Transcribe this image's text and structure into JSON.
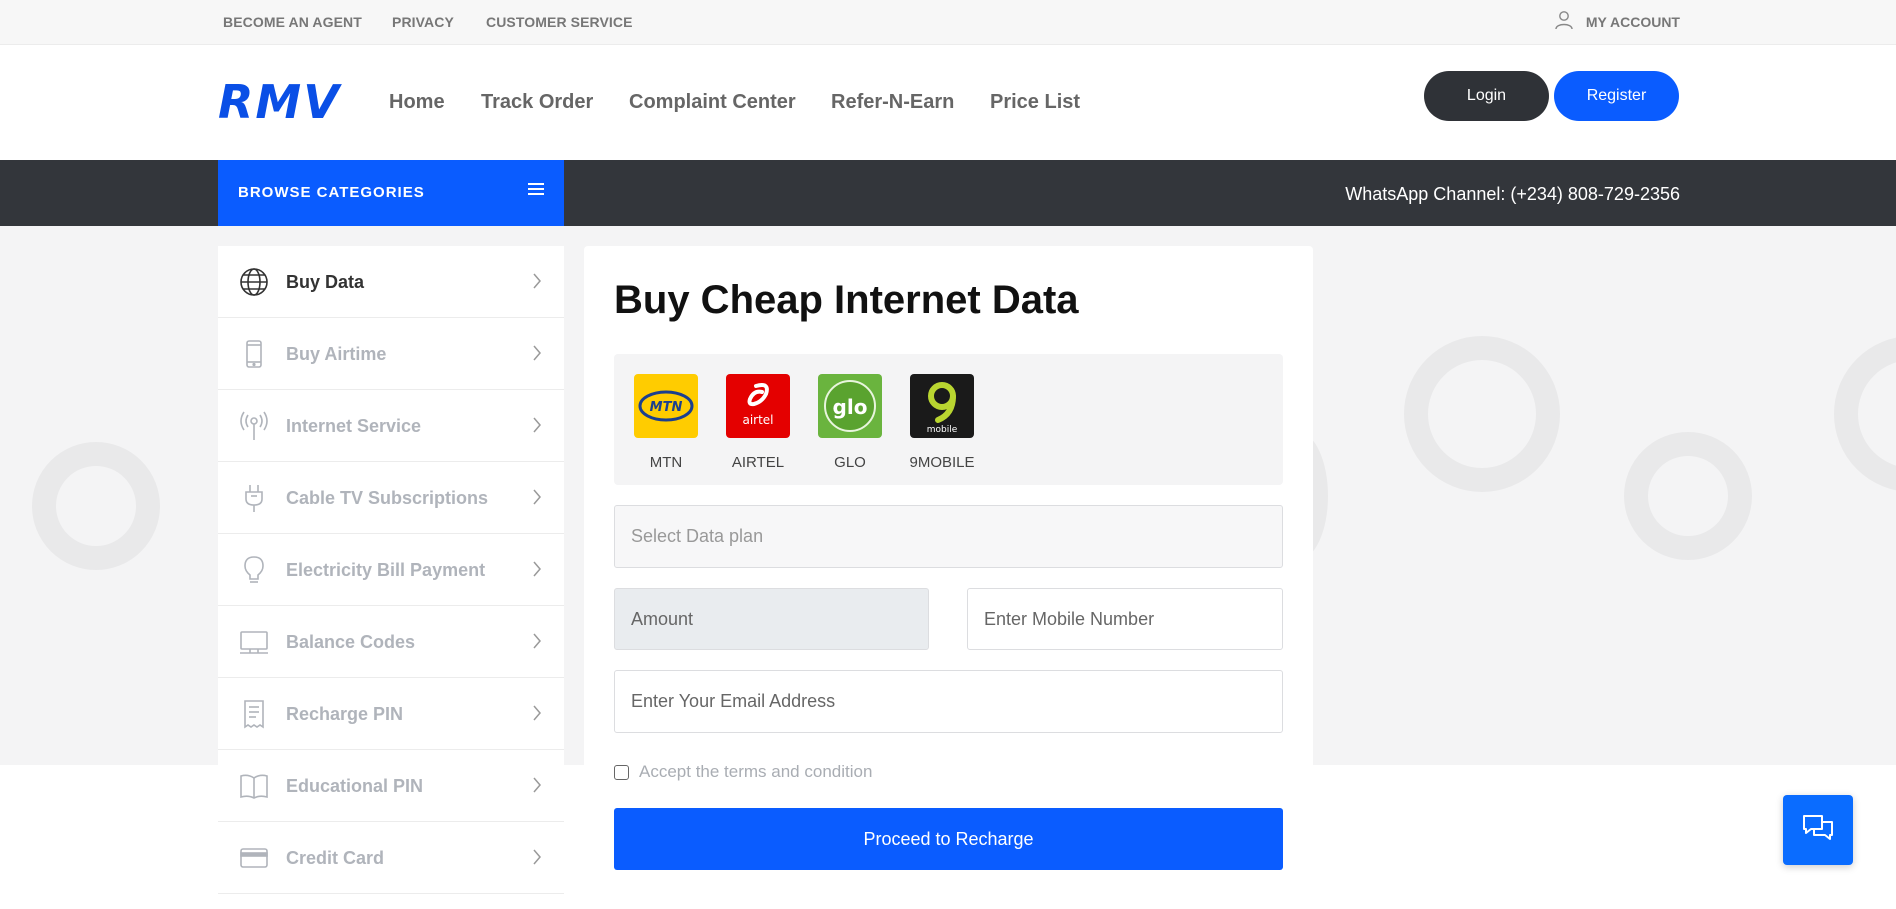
{
  "topbar": {
    "links": [
      "BECOME AN AGENT",
      "PRIVACY",
      "CUSTOMER SERVICE"
    ],
    "account": "MY ACCOUNT"
  },
  "header": {
    "logo": "RMV",
    "nav": [
      "Home",
      "Track Order",
      "Complaint Center",
      "Refer-N-Earn",
      "Price List"
    ],
    "login": "Login",
    "register": "Register"
  },
  "categorybar": {
    "browse": "BROWSE CATEGORIES",
    "whatsapp": "WhatsApp Channel: (+234) 808-729-2356"
  },
  "sidebar": {
    "items": [
      {
        "label": "Buy Data",
        "icon": "globe-icon",
        "active": true
      },
      {
        "label": "Buy Airtime",
        "icon": "phone-icon",
        "active": false
      },
      {
        "label": "Internet Service",
        "icon": "antenna-icon",
        "active": false
      },
      {
        "label": "Cable TV Subscriptions",
        "icon": "plug-icon",
        "active": false
      },
      {
        "label": "Electricity Bill Payment",
        "icon": "bulb-icon",
        "active": false
      },
      {
        "label": "Balance Codes",
        "icon": "monitor-icon",
        "active": false
      },
      {
        "label": "Recharge PIN",
        "icon": "receipt-icon",
        "active": false
      },
      {
        "label": "Educational PIN",
        "icon": "book-icon",
        "active": false
      },
      {
        "label": "Credit Card",
        "icon": "credit-card-icon",
        "active": false
      }
    ]
  },
  "main": {
    "title": "Buy Cheap Internet Data",
    "networks": [
      {
        "name": "MTN",
        "logo_text": "MTN",
        "color": "#ffcc00"
      },
      {
        "name": "AIRTEL",
        "logo_text": "airtel",
        "color": "#e40000"
      },
      {
        "name": "GLO",
        "logo_text": "glo",
        "color": "#6ab43e"
      },
      {
        "name": "9MOBILE",
        "logo_text": "mobile",
        "color": "#1a1a1a"
      }
    ],
    "data_plan_placeholder": "Select Data plan",
    "amount_placeholder": "Amount",
    "mobile_placeholder": "Enter Mobile Number",
    "email_placeholder": "Enter Your Email Address",
    "terms": "Accept the terms and condition",
    "proceed": "Proceed to Recharge"
  },
  "colors": {
    "primary": "#0a5cff",
    "dark": "#33363b"
  }
}
